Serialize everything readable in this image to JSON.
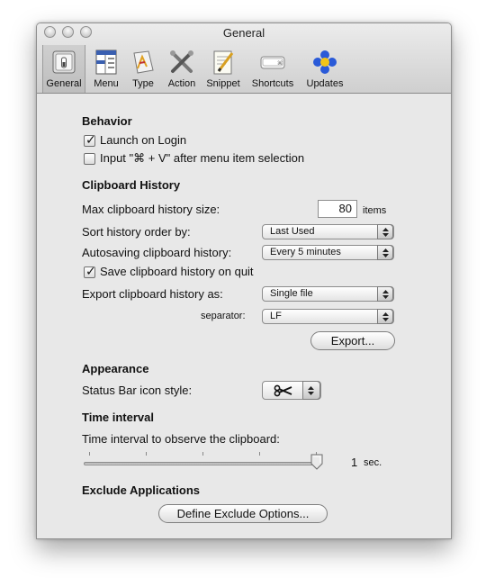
{
  "window": {
    "title": "General"
  },
  "toolbar": {
    "items": [
      {
        "label": "General",
        "icon": "switch-icon"
      },
      {
        "label": "Menu",
        "icon": "menu-layout-icon"
      },
      {
        "label": "Type",
        "icon": "type-icon"
      },
      {
        "label": "Action",
        "icon": "tools-icon"
      },
      {
        "label": "Snippet",
        "icon": "snippet-icon"
      },
      {
        "label": "Shortcuts",
        "icon": "keyboard-key-icon"
      },
      {
        "label": "Updates",
        "icon": "updates-icon"
      }
    ],
    "selected": "General"
  },
  "behavior": {
    "heading": "Behavior",
    "launch_on_login": {
      "label": "Launch on Login",
      "checked": true
    },
    "input_paste": {
      "label": "Input \"⌘ + V\" after menu item selection",
      "checked": false
    }
  },
  "clipboard_history": {
    "heading": "Clipboard History",
    "max_size_label": "Max clipboard history size:",
    "max_size_value": "80",
    "max_size_unit": "items",
    "sort_label": "Sort history order by:",
    "sort_value": "Last Used",
    "autosave_label": "Autosaving clipboard history:",
    "autosave_value": "Every 5 minutes",
    "save_on_quit": {
      "label": "Save clipboard history on quit",
      "checked": true
    },
    "export_label": "Export clipboard history as:",
    "export_value": "Single file",
    "separator_label": "separator:",
    "separator_value": "LF",
    "export_button": "Export..."
  },
  "appearance": {
    "heading": "Appearance",
    "status_bar_label": "Status Bar icon style:",
    "status_bar_icon": "scissors-icon"
  },
  "time_interval": {
    "heading": "Time interval",
    "label": "Time interval to observe the clipboard:",
    "value": "1",
    "unit": "sec.",
    "slider_fraction": 1.0
  },
  "exclude": {
    "heading": "Exclude Applications",
    "button": "Define Exclude Options..."
  }
}
